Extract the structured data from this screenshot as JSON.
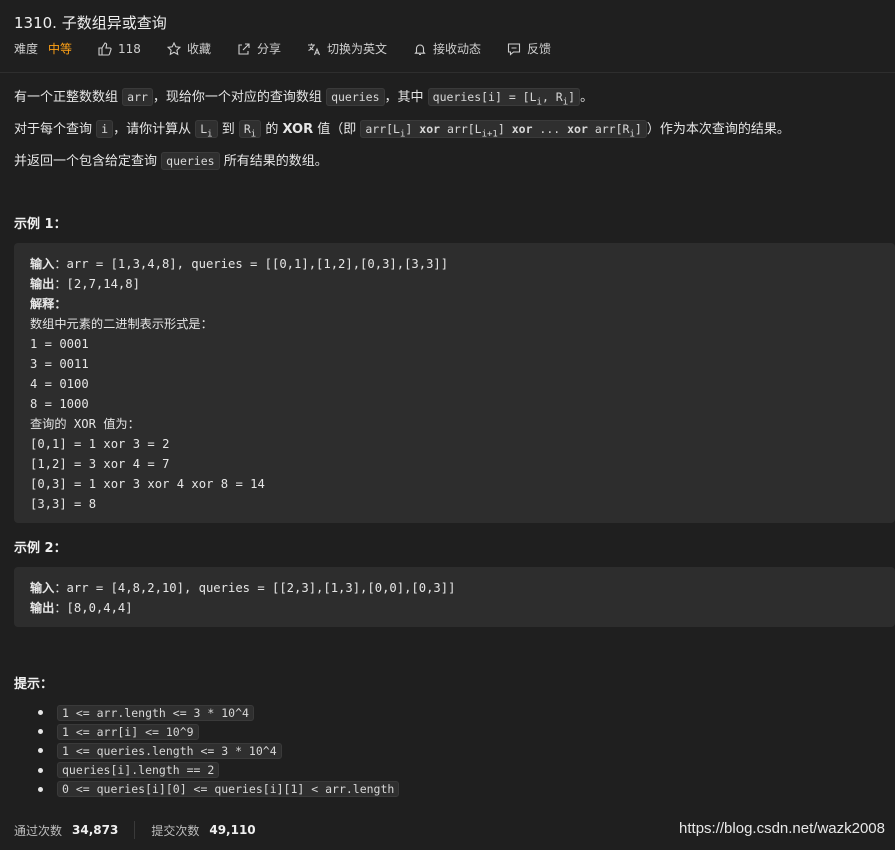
{
  "problem": {
    "title": "1310. 子数组异或查询",
    "difficulty_label": "难度",
    "difficulty": "中等",
    "likes": "118",
    "favorite": "收藏",
    "share": "分享",
    "switch_english": "切换为英文",
    "notify": "接收动态",
    "feedback": "反馈"
  },
  "description": {
    "line1": {
      "a": "有一个正整数数组 ",
      "code1": "arr",
      "b": "，现给你一个对应的查询数组 ",
      "code2": "queries",
      "c": "，其中 ",
      "code3a": "queries[i] = [L",
      "sub1": "i",
      "code3b": ", R",
      "sub2": "i",
      "code3c": "]",
      "d": "。"
    },
    "line2": {
      "a": "对于每个查询 ",
      "code1": "i",
      "b": "，请你计算从 ",
      "code2": "L",
      "sub2": "i",
      "c": " 到 ",
      "code3": "R",
      "sub3": "i",
      "d": " 的 ",
      "xor": "XOR",
      "e": " 值（即 ",
      "code4a": "arr[L",
      "code4sub1": "i",
      "code4b": "] ",
      "kw1": "xor",
      "code4c": " arr[L",
      "code4sub2": "i+1",
      "code4d": "] ",
      "kw2": "xor",
      "code4e": " ... ",
      "kw3": "xor",
      "code4f": " arr[R",
      "code4sub3": "i",
      "code4g": "]",
      "f": "）作为本次查询的结果。"
    },
    "line3": {
      "a": "并返回一个包含给定查询 ",
      "code1": "queries",
      "b": " 所有结果的数组。"
    }
  },
  "example1": {
    "heading": "示例 1：",
    "input_label": "输入",
    "input": "：arr = [1,3,4,8], queries = [[0,1],[1,2],[0,3],[3,3]]",
    "output_label": "输出",
    "output": "：[2,7,14,8]",
    "explain_label": "解释",
    "explain_colon": "：",
    "lines": [
      "数组中元素的二进制表示形式是：",
      "1 = 0001",
      "3 = 0011",
      "4 = 0100",
      "8 = 1000",
      "查询的 XOR 值为：",
      "[0,1] = 1 xor 3 = 2",
      "[1,2] = 3 xor 4 = 7",
      "[0,3] = 1 xor 3 xor 4 xor 8 = 14",
      "[3,3] = 8"
    ]
  },
  "example2": {
    "heading": "示例 2：",
    "input_label": "输入",
    "input": "：arr = [4,8,2,10], queries = [[2,3],[1,3],[0,0],[0,3]]",
    "output_label": "输出",
    "output": "：[8,0,4,4]"
  },
  "hints": {
    "heading": "提示：",
    "items": [
      "1 <= arr.length <= 3 * 10^4",
      "1 <= arr[i] <= 10^9",
      "1 <= queries.length <= 3 * 10^4",
      "queries[i].length == 2",
      "0 <= queries[i][0] <= queries[i][1] < arr.length"
    ]
  },
  "footer": {
    "accepted_label": "通过次数",
    "accepted": "34,873",
    "submissions_label": "提交次数",
    "submissions": "49,110"
  },
  "watermark": "https://blog.csdn.net/wazk2008"
}
